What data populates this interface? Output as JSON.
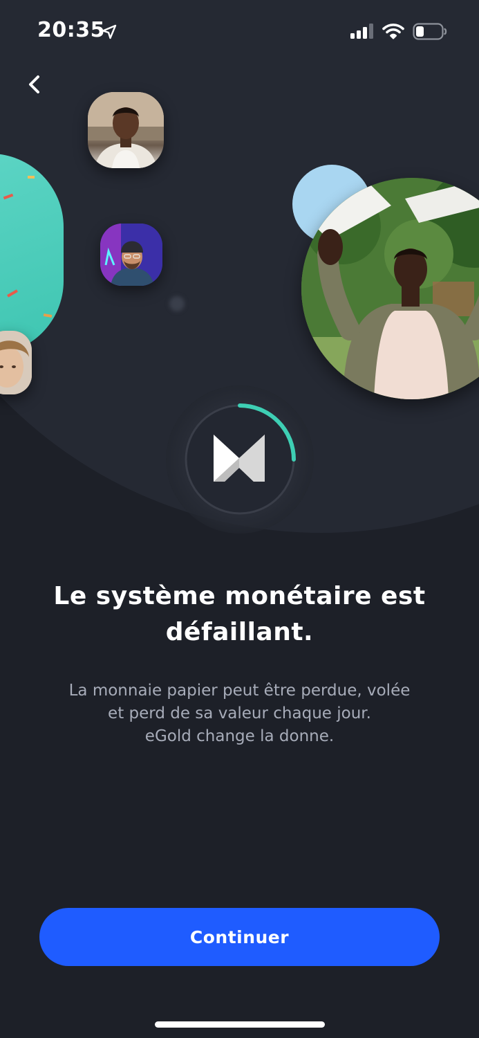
{
  "status_bar": {
    "time": "20:35",
    "icons": [
      "location-arrow-icon",
      "cellular-signal-icon",
      "wifi-icon",
      "battery-icon"
    ]
  },
  "navigation": {
    "back_icon": "chevron-left-icon"
  },
  "illustration": {
    "photos": [
      "person-portrait-1",
      "person-portrait-2",
      "person-portrait-3",
      "person-celebrating"
    ],
    "loader_progress": 0.25,
    "logo": "m-logo"
  },
  "content": {
    "headline": "Le système monétaire est défaillant.",
    "description_lines": [
      "La monnaie papier peut être perdue, volée",
      "et perd de sa valeur chaque jour.",
      "eGold change la donne."
    ]
  },
  "actions": {
    "continue_label": "Continuer"
  },
  "colors": {
    "background": "#1d2028",
    "primary_button": "#1f5cff",
    "accent_teal": "#3ecfb4",
    "muted_text": "#a7acb9"
  }
}
